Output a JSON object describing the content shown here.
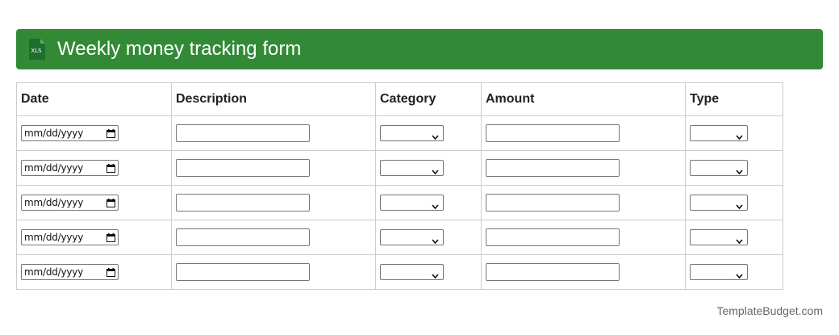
{
  "header": {
    "title": "Weekly money tracking form",
    "icon": "xls-file-icon",
    "icon_label": "XLS",
    "background_color": "#338a36"
  },
  "table": {
    "columns": [
      "Date",
      "Description",
      "Category",
      "Amount",
      "Type"
    ],
    "rows": [
      {
        "date_placeholder": "mm/dd/yyyy",
        "description": "",
        "category": "",
        "amount": "",
        "type": ""
      },
      {
        "date_placeholder": "mm/dd/yyyy",
        "description": "",
        "category": "",
        "amount": "",
        "type": ""
      },
      {
        "date_placeholder": "mm/dd/yyyy",
        "description": "",
        "category": "",
        "amount": "",
        "type": ""
      },
      {
        "date_placeholder": "mm/dd/yyyy",
        "description": "",
        "category": "",
        "amount": "",
        "type": ""
      },
      {
        "date_placeholder": "mm/dd/yyyy",
        "description": "",
        "category": "",
        "amount": "",
        "type": ""
      }
    ]
  },
  "footer": {
    "watermark": "TemplateBudget.com"
  }
}
